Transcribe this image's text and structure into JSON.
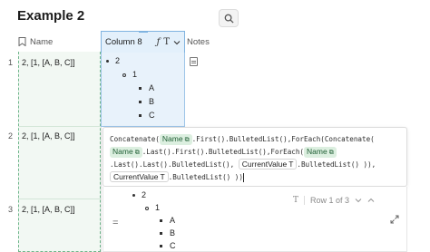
{
  "page": {
    "title": "Example 2"
  },
  "search": {
    "icon": "search-icon"
  },
  "columns": {
    "name": "Name",
    "col8": "Column 8",
    "col8_icons": [
      "function-icon",
      "text-type-icon",
      "chevron-down-icon"
    ],
    "notes": "Notes"
  },
  "rows": [
    {
      "num": "1",
      "name": "2, [1, [A, B, C]]"
    },
    {
      "num": "2",
      "name": "2, [1, [A, B, C]]"
    },
    {
      "num": "3",
      "name": "2, [1, [A, B, C]]"
    }
  ],
  "bullets": {
    "l1": "2",
    "l2": "1",
    "l3": [
      "A",
      "B",
      "C"
    ]
  },
  "formula": {
    "line1_a": "Concatenate(",
    "chip_name": "Name",
    "line1_b": ".First().BulletedList(),ForEach(Concatenate(",
    "line2_b": ".Last().First().BulletedList(),ForEach(",
    "line3_a": ".Last().Last().BulletedList(), ",
    "chip_current": "CurrentValue",
    "chip_text_glyph": "T",
    "line3_b": ".BulletedList() )),",
    "line4_b": ".BulletedList() ))"
  },
  "preview": {
    "eq": "=",
    "result_label": "Row 1 of 3",
    "bullets": {
      "l1": "2",
      "l2": "1",
      "l3": [
        "A",
        "B",
        "C"
      ]
    }
  }
}
